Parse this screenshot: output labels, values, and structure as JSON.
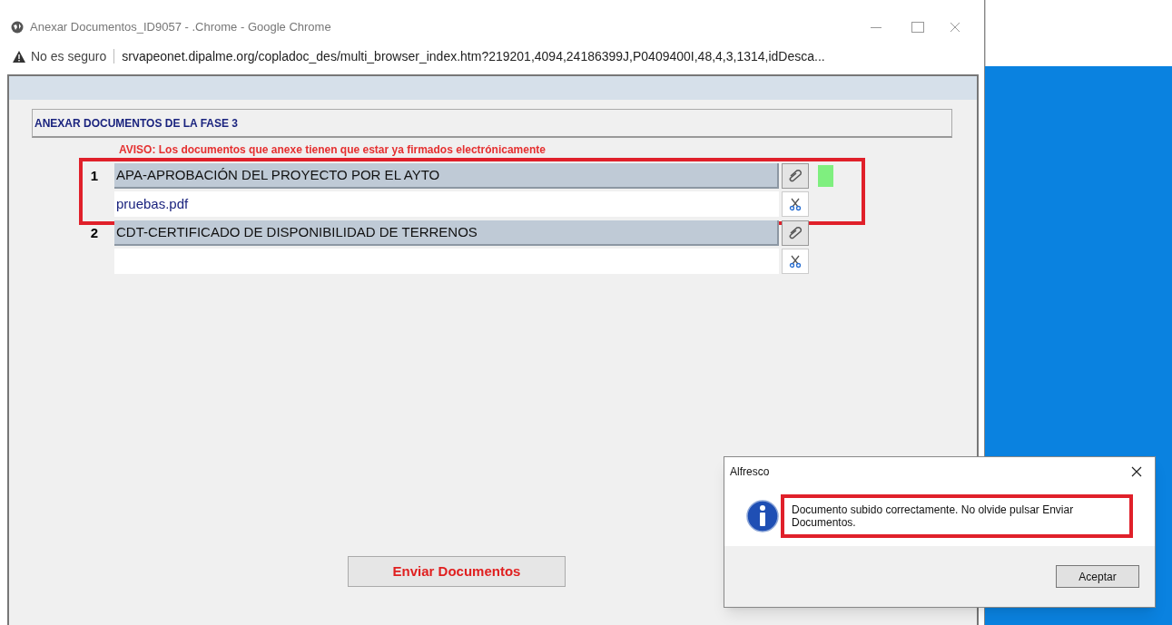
{
  "window": {
    "title": "Anexar Documentos_ID9057 - .Chrome - Google Chrome"
  },
  "address_bar": {
    "security": "No es seguro",
    "url": "srvapeonet.dipalme.org/copladoc_des/multi_browser_index.htm?219201,4094,24186399J,P0409400I,48,4,3,1314,idDesca..."
  },
  "section_title": "ANEXAR DOCUMENTOS DE LA FASE 3",
  "notice": "AVISO: Los documentos que anexe tienen que estar ya firmados electrónicamente",
  "documents": [
    {
      "number": "1",
      "name": "APA-APROBACIÓN DEL PROYECTO POR EL AYTO",
      "file": "pruebas.pdf",
      "uploaded": true,
      "highlighted": true
    },
    {
      "number": "2",
      "name": "CDT-CERTIFICADO DE DISPONIBILIDAD DE TERRENOS",
      "uploaded": false,
      "highlighted": false
    }
  ],
  "submit_button": "Enviar Documentos",
  "dialog": {
    "title": "Alfresco",
    "message": "Documento subido correctamente. No olvide pulsar Enviar Documentos.",
    "button": "Aceptar"
  }
}
